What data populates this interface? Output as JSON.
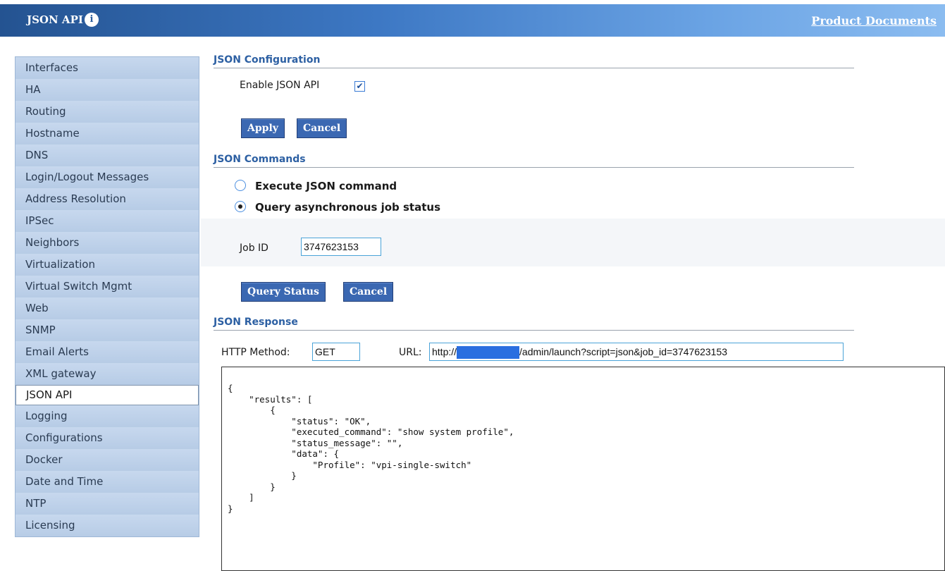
{
  "header": {
    "title": "JSON API",
    "info_icon": "info-icon",
    "docs_link": "Product Documents",
    "gradient_colors": [
      "#245391",
      "#8bbcf0"
    ]
  },
  "sidebar": {
    "active": "JSON API",
    "items": [
      {
        "label": "Interfaces"
      },
      {
        "label": "HA"
      },
      {
        "label": "Routing"
      },
      {
        "label": "Hostname"
      },
      {
        "label": "DNS"
      },
      {
        "label": "Login/Logout Messages"
      },
      {
        "label": "Address Resolution"
      },
      {
        "label": "IPSec"
      },
      {
        "label": "Neighbors"
      },
      {
        "label": "Virtualization"
      },
      {
        "label": "Virtual Switch Mgmt"
      },
      {
        "label": "Web"
      },
      {
        "label": "SNMP"
      },
      {
        "label": "Email Alerts"
      },
      {
        "label": "XML gateway"
      },
      {
        "label": "JSON API"
      },
      {
        "label": "Logging"
      },
      {
        "label": "Configurations"
      },
      {
        "label": "Docker"
      },
      {
        "label": "Date and Time"
      },
      {
        "label": "NTP"
      },
      {
        "label": "Licensing"
      }
    ]
  },
  "config": {
    "heading": "JSON Configuration",
    "enable_label": "Enable JSON API",
    "enable_checked": true,
    "apply_label": "Apply",
    "cancel_label": "Cancel"
  },
  "commands": {
    "heading": "JSON Commands",
    "options": [
      {
        "label": "Execute JSON command",
        "checked": false
      },
      {
        "label": "Query asynchronous job status",
        "checked": true
      }
    ],
    "job_id_label": "Job ID",
    "job_id_value": "3747623153",
    "query_label": "Query Status",
    "cancel_label": "Cancel"
  },
  "response": {
    "heading": "JSON Response",
    "method_label": "HTTP Method:",
    "method_value": "GET",
    "url_label": "URL:",
    "url_prefix": "http://",
    "url_suffix": "/admin/launch?script=json&job_id=3747623153",
    "body": "{\n    \"results\": [\n        {\n            \"status\": \"OK\",\n            \"executed_command\": \"show system profile\",\n            \"status_message\": \"\",\n            \"data\": {\n                \"Profile\": \"vpi-single-switch\"\n            }\n        }\n    ]\n}"
  }
}
